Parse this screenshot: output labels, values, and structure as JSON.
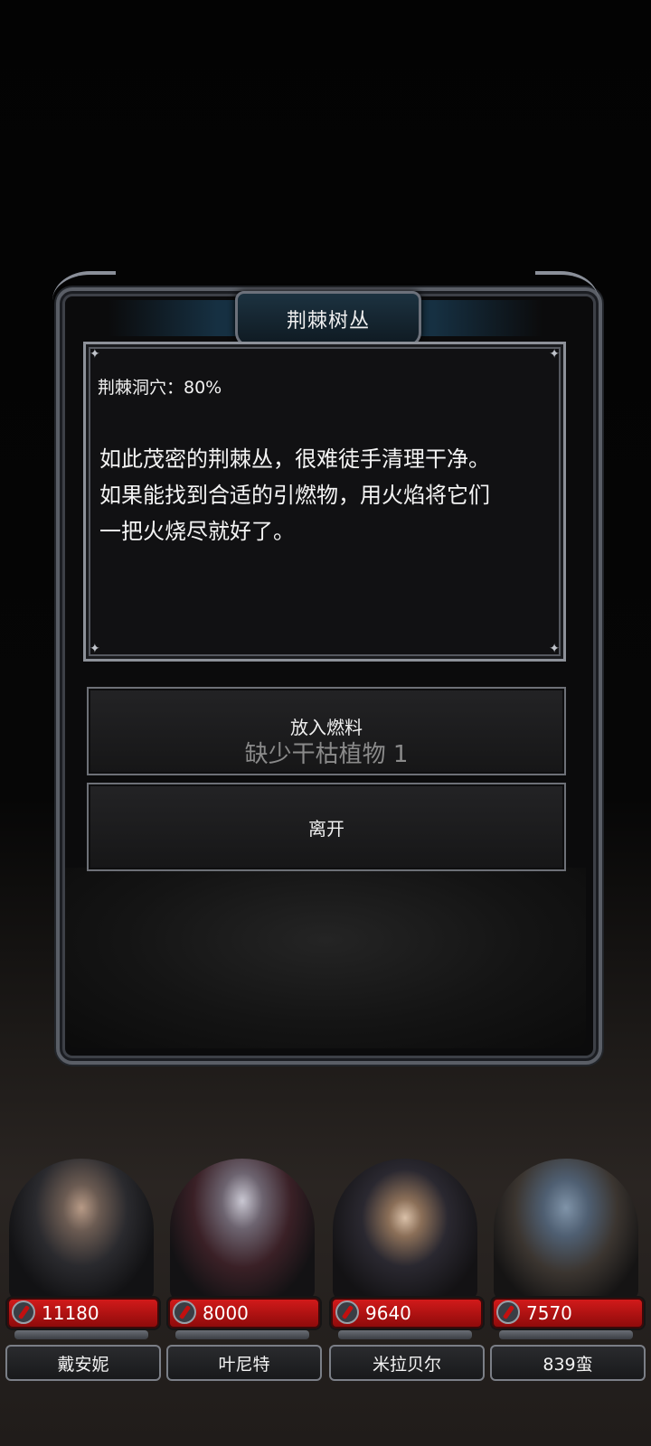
{
  "dialog": {
    "title": "荆棘树丛",
    "subtitle": "荆棘洞穴：80%",
    "description": "如此茂密的荆棘丛，很难徒手清理干净。\n如果能找到合适的引燃物，用火焰将它们\n一把火烧尽就好了。"
  },
  "actions": {
    "fuel_label": "放入燃料",
    "fuel_requirement": "缺少干枯植物 1",
    "leave_label": "离开"
  },
  "party": [
    {
      "name": "戴安妮",
      "hp": "11180"
    },
    {
      "name": "叶尼特",
      "hp": "8000"
    },
    {
      "name": "米拉贝尔",
      "hp": "9640"
    },
    {
      "name": "839蛮",
      "hp": "7570"
    }
  ],
  "colors": {
    "hp_bar": "#c41414",
    "frame": "#5a5e66",
    "title_bg": "#163042"
  }
}
